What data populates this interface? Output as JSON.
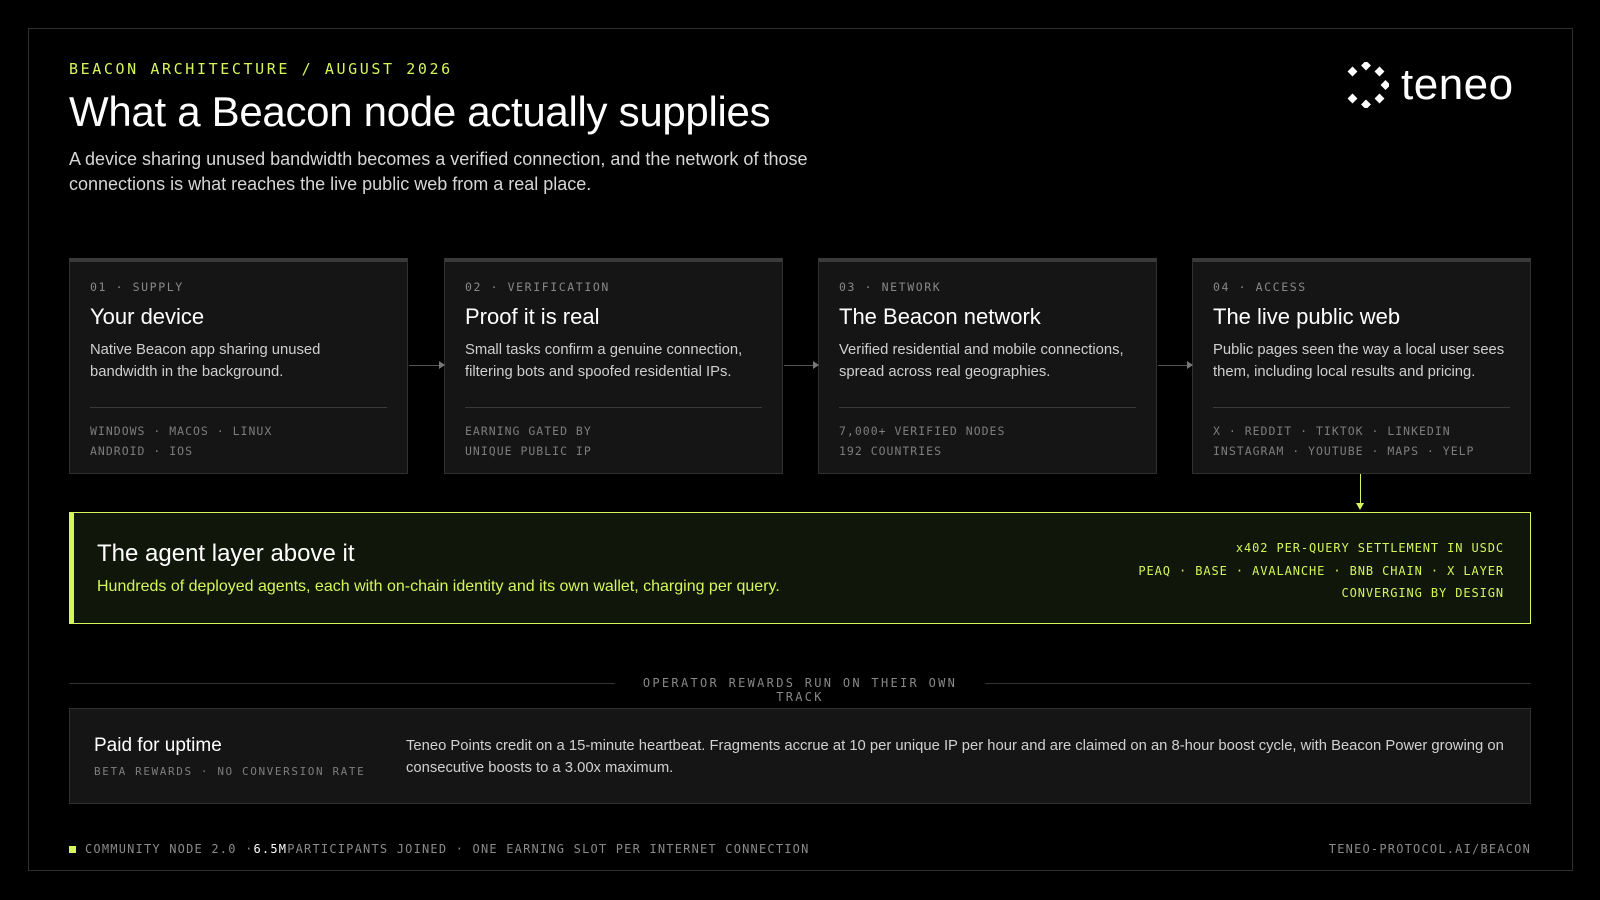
{
  "header": {
    "eyebrow": "BEACON ARCHITECTURE / AUGUST 2026",
    "title": "What a Beacon node actually supplies",
    "subtitle": "A device sharing unused bandwidth becomes a verified connection, and the network of those connections is what reaches the live public web from a real place."
  },
  "logo": {
    "text": "teneo",
    "icon": "dotted-ring-logo-icon"
  },
  "steps": [
    {
      "label": "01 · SUPPLY",
      "title": "Your device",
      "desc": "Native Beacon app sharing unused bandwidth in the background.",
      "meta1": "WINDOWS · MACOS · LINUX",
      "meta2": "ANDROID · IOS"
    },
    {
      "label": "02 · VERIFICATION",
      "title": "Proof it is real",
      "desc": "Small tasks confirm a genuine connection, filtering bots and spoofed residential IPs.",
      "meta1": "EARNING GATED BY",
      "meta2": "UNIQUE PUBLIC IP"
    },
    {
      "label": "03 · NETWORK",
      "title": "The Beacon network",
      "desc": "Verified residential and mobile connections, spread across real geographies.",
      "meta1": "7,000+ VERIFIED NODES",
      "meta2": "192 COUNTRIES"
    },
    {
      "label": "04 · ACCESS",
      "title": "The live public web",
      "desc": "Public pages seen the way a local user sees them, including local results and pricing.",
      "meta1": "X · REDDIT · TIKTOK · LINKEDIN",
      "meta2": "INSTAGRAM · YOUTUBE · MAPS · YELP"
    }
  ],
  "agent": {
    "title": "The agent layer above it",
    "desc": "Hundreds of deployed agents, each with on-chain identity and its own wallet, charging per query.",
    "right1": "x402 PER-QUERY SETTLEMENT IN USDC",
    "right2": "PEAQ · BASE · AVALANCHE · BNB CHAIN · X LAYER",
    "right3": "CONVERGING BY DESIGN"
  },
  "separator": "OPERATOR REWARDS RUN ON THEIR OWN TRACK",
  "rewards": {
    "title": "Paid for uptime",
    "sub": "BETA REWARDS · NO CONVERSION RATE",
    "desc": "Teneo Points credit on a 15-minute heartbeat. Fragments accrue at 10 per unique IP per hour and are claimed on an 8-hour boost cycle, with Beacon Power growing on consecutive boosts to a 3.00x maximum."
  },
  "footer": {
    "left_pre": "COMMUNITY NODE 2.0 · ",
    "left_highlight": "6.5M",
    "left_post": " PARTICIPANTS JOINED · ONE EARNING SLOT PER INTERNET CONNECTION",
    "right": "TENEO-PROTOCOL.AI/BEACON"
  },
  "colors": {
    "accent": "#d4f55c",
    "background": "#000000",
    "card": "#151515"
  }
}
